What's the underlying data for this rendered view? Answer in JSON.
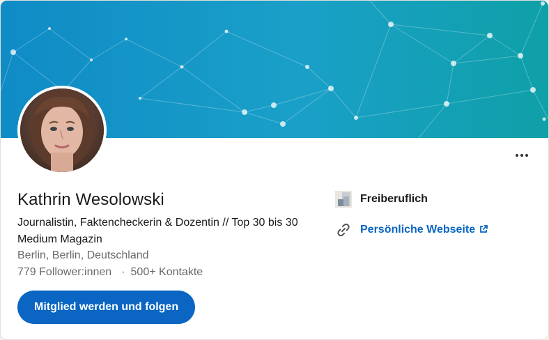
{
  "profile": {
    "name": "Kathrin Wesolowski",
    "headline": "Journalistin, Faktencheckerin & Dozentin // Top 30 bis 30 Medium Magazin",
    "location": "Berlin, Berlin, Deutschland",
    "followers": "779 Follower:innen",
    "separator": "·",
    "connections": "500+ Kontakte"
  },
  "actions": {
    "follow_label": "Mitglied werden und folgen",
    "more_icon": "ellipsis-icon"
  },
  "side": {
    "company_label": "Freiberuflich",
    "company_icon": "company-logo",
    "website_label": "Persönliche Webseite",
    "website_icon": "link-icon",
    "external_icon": "external-link-icon"
  },
  "colors": {
    "brand_blue": "#0a66c2",
    "banner_start": "#0f8bc6",
    "banner_end": "#0fa0a8"
  }
}
